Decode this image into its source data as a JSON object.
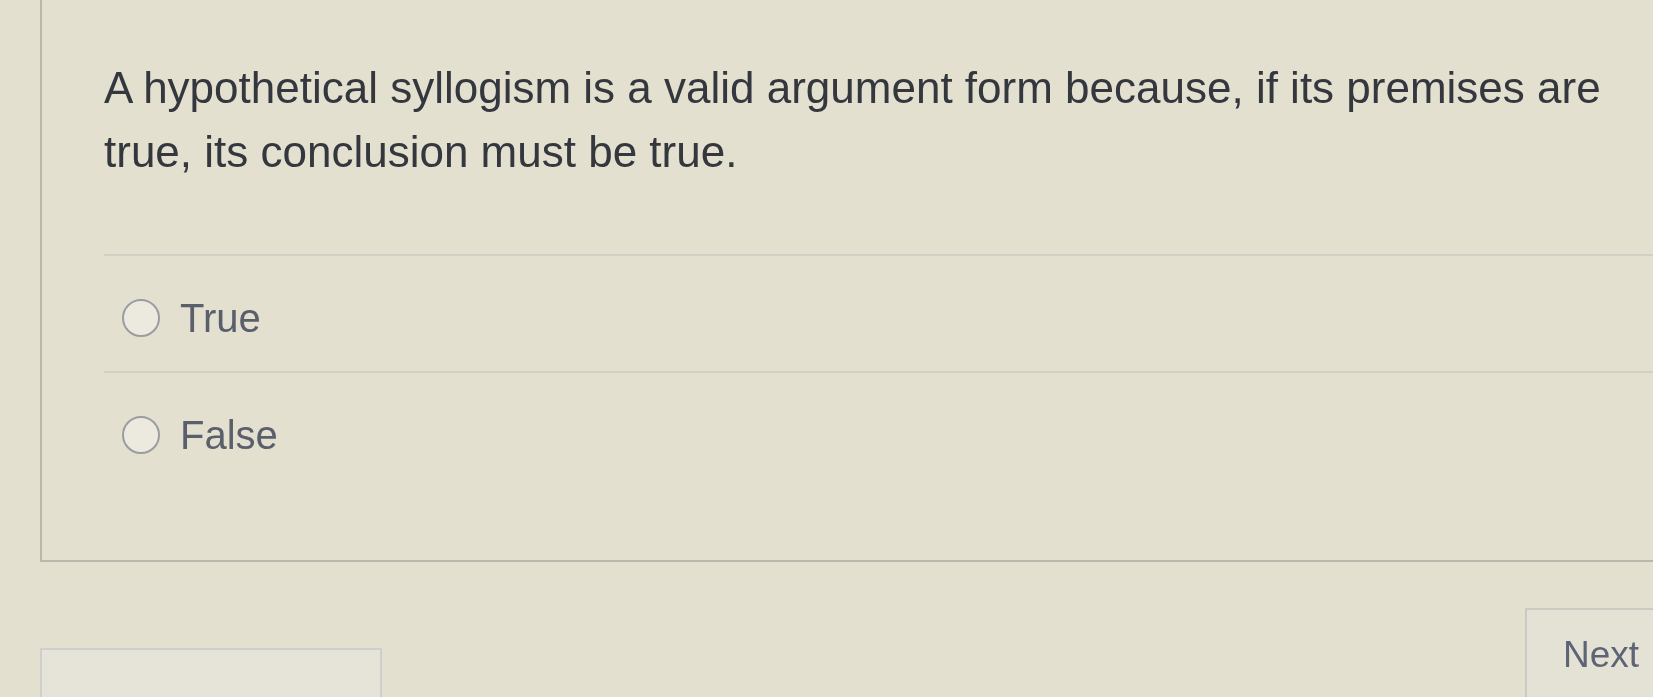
{
  "question": {
    "text": "A hypothetical syllogism is a valid argument form because, if its premises are true, its conclusion must be true."
  },
  "options": [
    {
      "label": "True",
      "selected": false
    },
    {
      "label": "False",
      "selected": false
    }
  ],
  "buttons": [
    {
      "label": "Next"
    }
  ]
}
